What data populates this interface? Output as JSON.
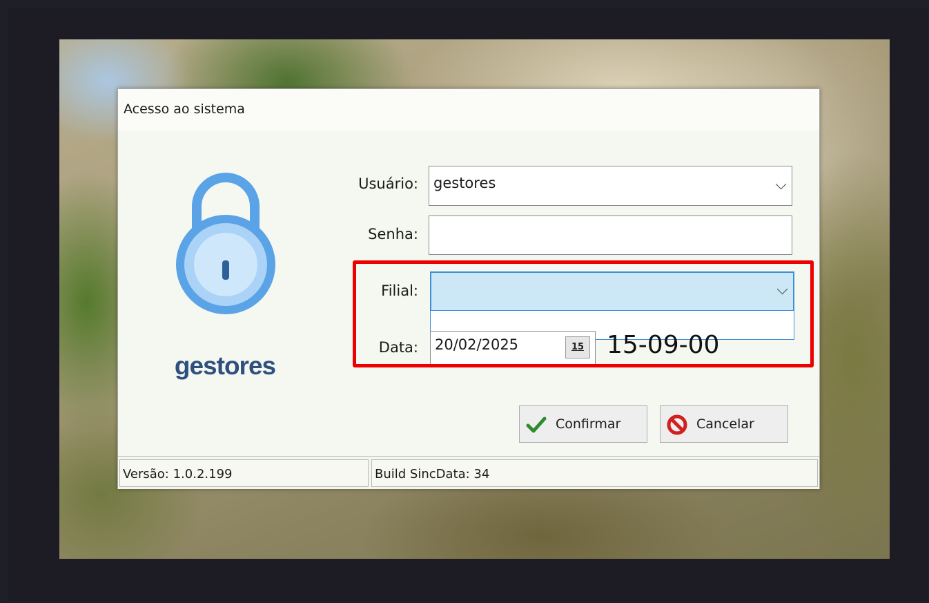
{
  "dialog": {
    "title": "Acesso ao sistema",
    "brand": "gestores"
  },
  "form": {
    "usuario": {
      "label": "Usuário:",
      "value": "gestores"
    },
    "senha": {
      "label": "Senha:",
      "value": ""
    },
    "filial": {
      "label": "Filial:",
      "value": ""
    },
    "data": {
      "label": "Data:",
      "date": "20/02/2025",
      "calendar_button": "15",
      "time": "15-09-00"
    }
  },
  "buttons": {
    "confirm": "Confirmar",
    "cancel": "Cancelar"
  },
  "status": {
    "version": "Versão: 1.0.2.199",
    "build": "Build SincData: 34"
  },
  "icons": {
    "lock": "lock-icon",
    "confirm": "checkmark-icon",
    "cancel": "prohibited-icon",
    "dropdown": "chevron-down-icon",
    "calendar": "calendar-icon"
  },
  "colors": {
    "highlight": "#ee0000",
    "brand": "#2f4f7f",
    "lock": "#5aa3e6",
    "selected_field": "#cce8f6",
    "confirm_check": "#2e8b2e",
    "cancel_icon": "#d21f1f"
  }
}
